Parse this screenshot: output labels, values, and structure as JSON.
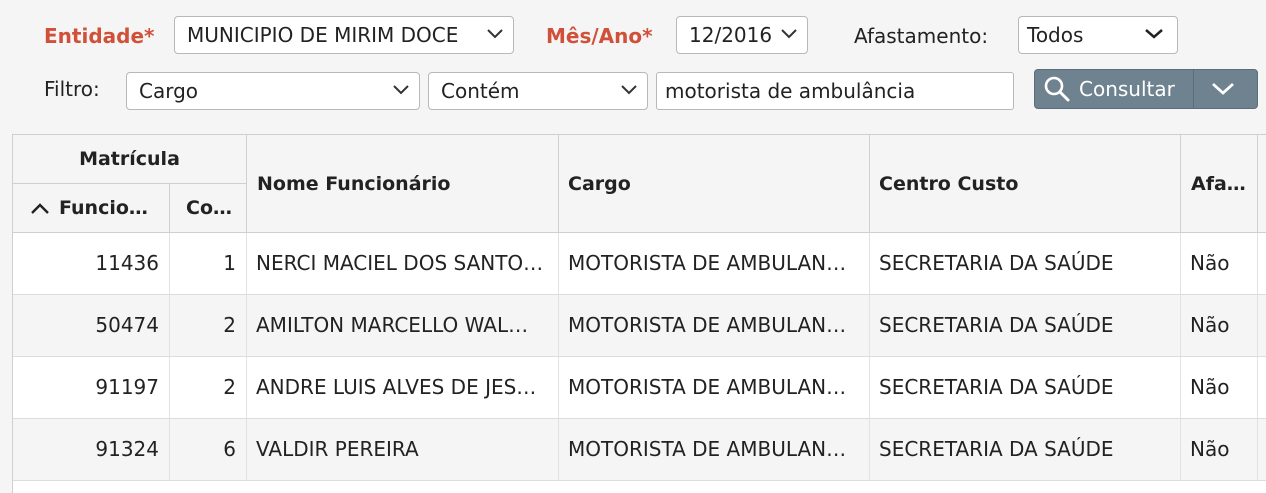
{
  "filters": {
    "entidade_label": "Entidade*",
    "entidade_value": "MUNICIPIO DE MIRIM DOCE",
    "mesano_label": "Mês/Ano*",
    "mesano_value": "12/2016",
    "afastamento_label": "Afastamento:",
    "afastamento_value": "Todos",
    "filtro_label": "Filtro:",
    "filtro_field_value": "Cargo",
    "filtro_operator_value": "Contém",
    "filtro_text_value": "motorista de ambulância",
    "consultar_label": "Consultar"
  },
  "table": {
    "group_header": "Matrícula",
    "columns": {
      "funcionario": "Funcio…",
      "contrato": "Co…",
      "nome": "Nome Funcionário",
      "cargo": "Cargo",
      "centro_custo": "Centro Custo",
      "afastado": "Afa…"
    },
    "rows": [
      {
        "funcionario": "11436",
        "contrato": "1",
        "nome": "NERCI MACIEL DOS SANTO…",
        "cargo": "MOTORISTA DE AMBULAN…",
        "centro_custo": "SECRETARIA DA SAÚDE",
        "afastado": "Não"
      },
      {
        "funcionario": "50474",
        "contrato": "2",
        "nome": "AMILTON MARCELLO WAL…",
        "cargo": "MOTORISTA DE AMBULAN…",
        "centro_custo": "SECRETARIA DA SAÚDE",
        "afastado": "Não"
      },
      {
        "funcionario": "91197",
        "contrato": "2",
        "nome": "ANDRE LUIS ALVES DE JES…",
        "cargo": "MOTORISTA DE AMBULAN…",
        "centro_custo": "SECRETARIA DA SAÚDE",
        "afastado": "Não"
      },
      {
        "funcionario": "91324",
        "contrato": "6",
        "nome": "VALDIR PEREIRA",
        "cargo": "MOTORISTA DE AMBULAN…",
        "centro_custo": "SECRETARIA DA SAÚDE",
        "afastado": "Não"
      }
    ]
  },
  "icons": {
    "dropdown": "chevron-down-icon",
    "search": "search-icon",
    "sort": "chevron-up-icon"
  },
  "colors": {
    "required_label": "#d1503a",
    "button": "#6f8290"
  }
}
